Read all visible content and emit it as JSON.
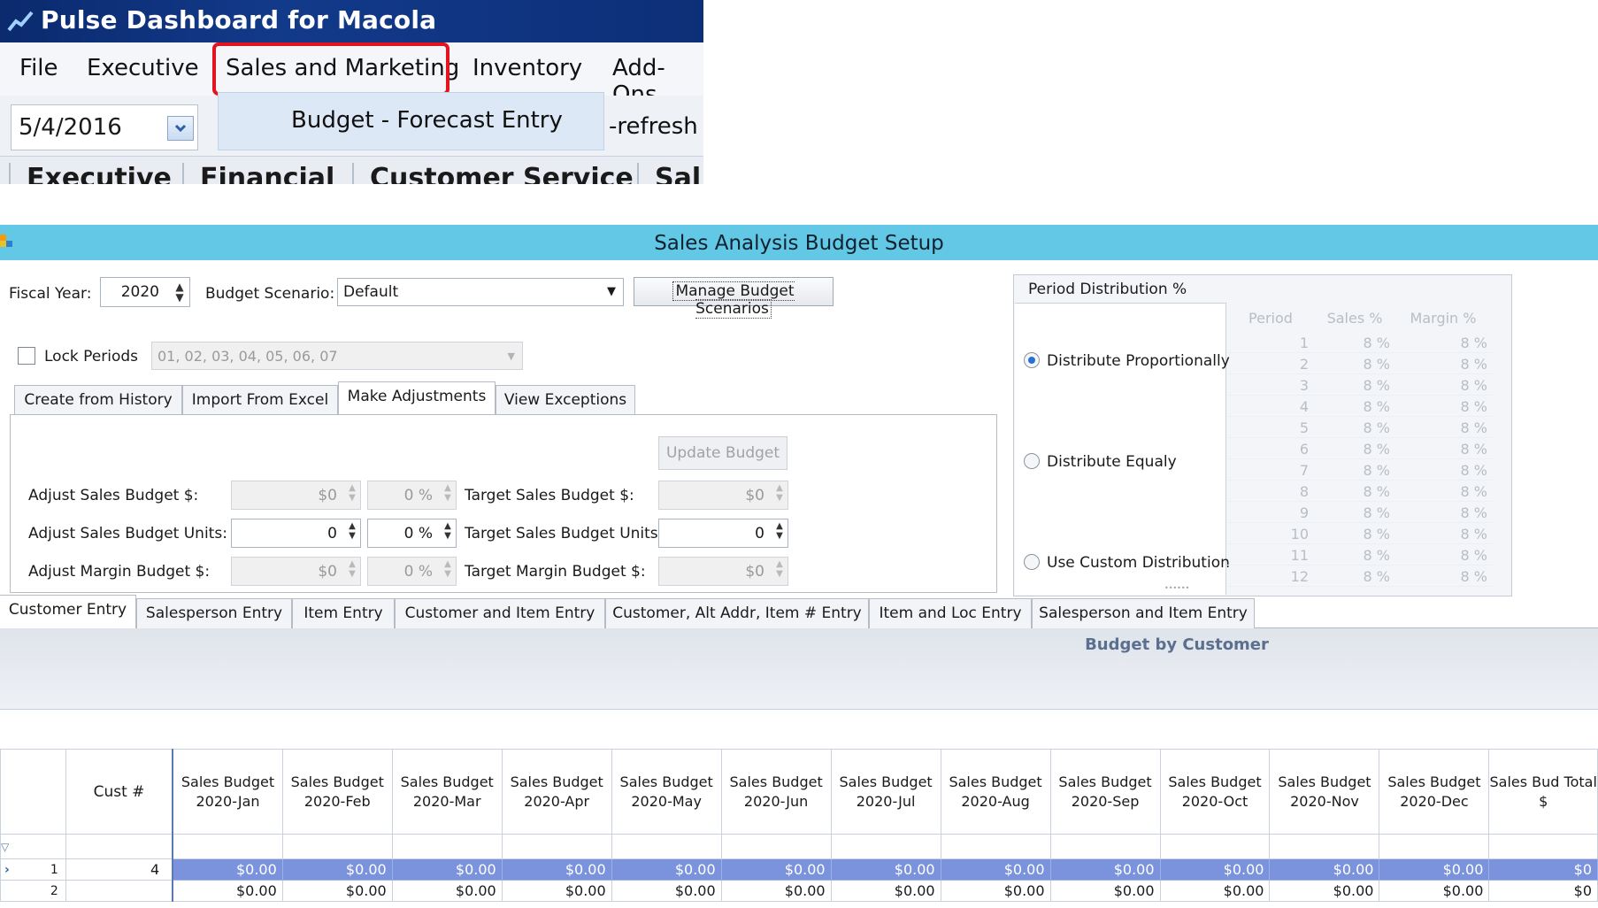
{
  "top": {
    "app_title": "Pulse Dashboard for Macola",
    "menu": [
      "File",
      "Executive",
      "Sales and Marketing",
      "Inventory",
      "Add-Ons"
    ],
    "date_value": "5/4/2016",
    "dropdown_item": "Budget - Forecast Entry",
    "refresh_text": "-refresh",
    "tabs": [
      "Executive",
      "Financial",
      "Customer Service",
      "Sal"
    ]
  },
  "window": {
    "title": "Sales Analysis Budget Setup",
    "fiscal_year_label": "Fiscal Year:",
    "fiscal_year_value": "2020",
    "scenario_label": "Budget Scenario:",
    "scenario_value": "Default",
    "manage_button": "Manage Budget Scenarios",
    "lock_label": "Lock Periods",
    "lock_periods_value": "01, 02, 03, 04, 05, 06, 07",
    "tabs": [
      "Create from History",
      "Import From Excel",
      "Make Adjustments",
      "View Exceptions"
    ],
    "update_button": "Update Budget",
    "adjust_rows": [
      {
        "label": "Adjust Sales Budget $:",
        "value": "$0",
        "pct": "0 %",
        "target_label": "Target Sales Budget $:",
        "target_value": "$0"
      },
      {
        "label": "Adjust Sales Budget Units:",
        "value": "0",
        "pct": "0 %",
        "target_label": "Target Sales Budget Units:",
        "target_value": "0"
      },
      {
        "label": "Adjust Margin Budget $:",
        "value": "$0",
        "pct": "0 %",
        "target_label": "Target Margin Budget $:",
        "target_value": "$0"
      }
    ],
    "period_dist": {
      "title": "Period Distribution %",
      "options": [
        "Distribute Proportionally",
        "Distribute Equaly",
        "Use Custom Distribution"
      ],
      "headers": [
        "Period",
        "Sales %",
        "Margin %"
      ],
      "rows": [
        [
          "1",
          "8 %",
          "8 %"
        ],
        [
          "2",
          "8 %",
          "8 %"
        ],
        [
          "3",
          "8 %",
          "8 %"
        ],
        [
          "4",
          "8 %",
          "8 %"
        ],
        [
          "5",
          "8 %",
          "8 %"
        ],
        [
          "6",
          "8 %",
          "8 %"
        ],
        [
          "7",
          "8 %",
          "8 %"
        ],
        [
          "8",
          "8 %",
          "8 %"
        ],
        [
          "9",
          "8 %",
          "8 %"
        ],
        [
          "10",
          "8 %",
          "8 %"
        ],
        [
          "11",
          "8 %",
          "8 %"
        ],
        [
          "12",
          "8 %",
          "8 %"
        ]
      ]
    },
    "entry_tabs": [
      "Customer Entry",
      "Salesperson Entry",
      "Item Entry",
      "Customer and  Item Entry",
      "Customer, Alt Addr, Item # Entry",
      "Item and Loc Entry",
      "Salesperson and Item Entry"
    ],
    "grid_title": "Budget by Customer",
    "grid": {
      "cust_header": "Cust #",
      "month_headers": [
        "Sales Budget 2020-Jan",
        "Sales Budget 2020-Feb",
        "Sales Budget 2020-Mar",
        "Sales Budget 2020-Apr",
        "Sales Budget 2020-May",
        "Sales Budget 2020-Jun",
        "Sales Budget 2020-Jul",
        "Sales Budget 2020-Aug",
        "Sales Budget 2020-Sep",
        "Sales Budget 2020-Oct",
        "Sales Budget 2020-Nov",
        "Sales Budget 2020-Dec",
        "Sales Bud Total $"
      ],
      "rows": [
        {
          "num": "1",
          "cust": "4",
          "values": [
            "$0.00",
            "$0.00",
            "$0.00",
            "$0.00",
            "$0.00",
            "$0.00",
            "$0.00",
            "$0.00",
            "$0.00",
            "$0.00",
            "$0.00",
            "$0.00",
            "$0"
          ]
        },
        {
          "num": "2",
          "cust": "",
          "values": [
            "$0.00",
            "$0.00",
            "$0.00",
            "$0.00",
            "$0.00",
            "$0.00",
            "$0.00",
            "$0.00",
            "$0.00",
            "$0.00",
            "$0.00",
            "$0.00",
            "$0"
          ]
        }
      ]
    }
  }
}
